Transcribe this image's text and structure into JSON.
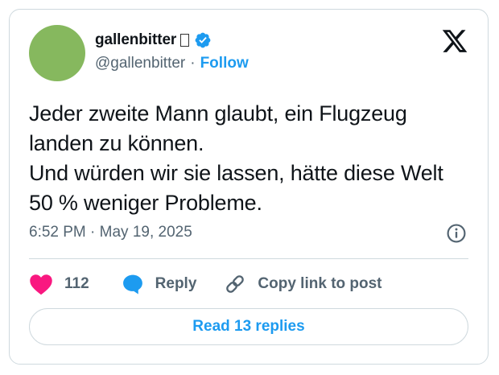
{
  "author": {
    "display_name": "gallenbitter",
    "handle": "@gallenbitter",
    "separator": "·",
    "follow_label": "Follow",
    "avatar_color": "#86b85e",
    "verified": true
  },
  "tweet": {
    "text": "Jeder zweite Mann glaubt, ein Flugzeug landen zu können.\nUnd würden wir sie lassen, hätte diese Welt 50 % weniger Probleme.",
    "timestamp": "6:52 PM · May 19, 2025"
  },
  "actions": {
    "like_count": "112",
    "reply_label": "Reply",
    "copy_link_label": "Copy link to post"
  },
  "read_replies_label": "Read 13 replies",
  "icons": {
    "logo": "x-logo-icon",
    "verified": "verified-badge-icon",
    "info": "info-icon",
    "like": "heart-icon",
    "reply": "speech-bubble-icon",
    "copy": "link-icon"
  },
  "colors": {
    "accent": "#1d9bf0",
    "like": "#f91880",
    "text": "#0f1419",
    "secondary": "#536471",
    "border": "#cfd9de"
  }
}
